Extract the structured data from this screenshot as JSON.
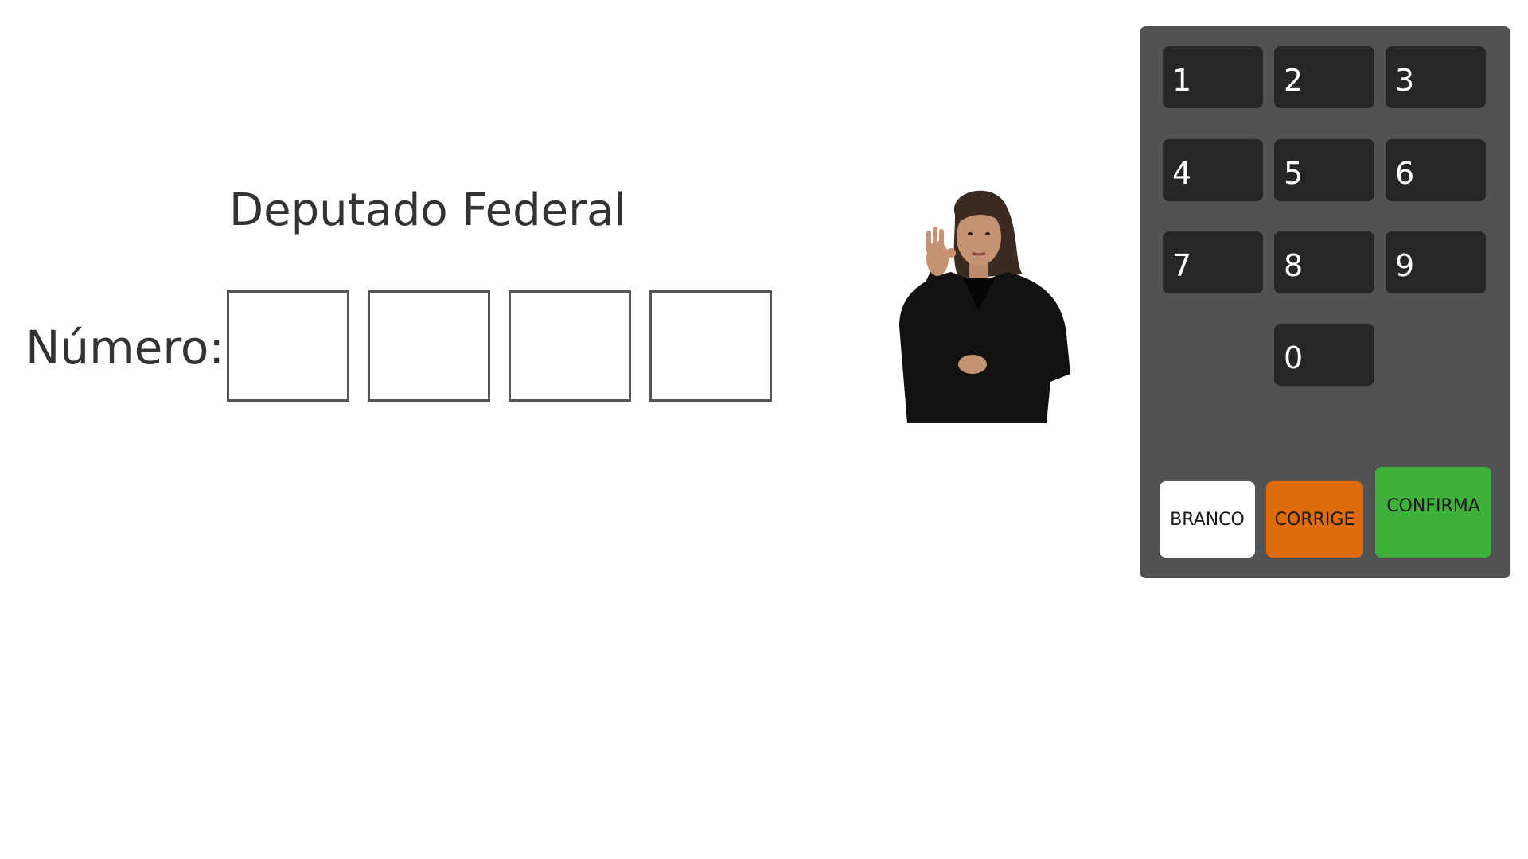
{
  "ballot": {
    "office_title": "Deputado Federal",
    "number_label": "Número:",
    "digits": [
      "",
      "",
      "",
      ""
    ]
  },
  "keypad": {
    "keys": [
      "1",
      "2",
      "3",
      "4",
      "5",
      "6",
      "7",
      "8",
      "9",
      "0"
    ],
    "branco_label": "BRANCO",
    "corrige_label": "CORRIGE",
    "confirma_label": "CONFIRMA"
  },
  "colors": {
    "panel": "#525252",
    "key": "#262626",
    "branco": "#ffffff",
    "corrige": "#e06b0a",
    "confirma": "#3eb13b"
  }
}
